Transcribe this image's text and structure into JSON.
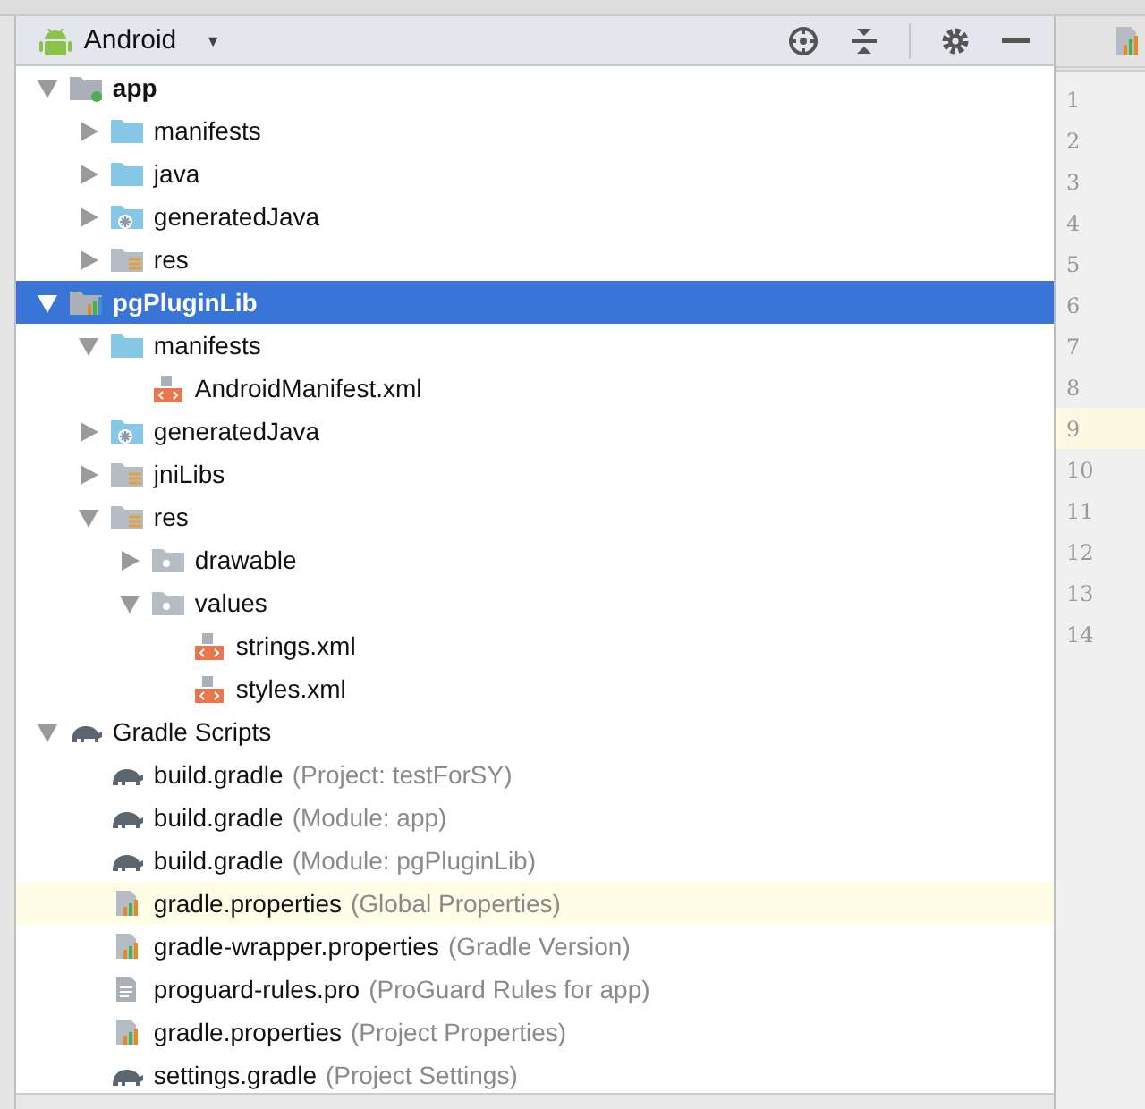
{
  "toolbar": {
    "view": "Android",
    "caret": "▼"
  },
  "tree": [
    {
      "label": "app",
      "kind": "module-app",
      "bold": true,
      "expanded": true,
      "selected": false,
      "children": [
        {
          "label": "manifests",
          "kind": "folder",
          "expanded": false,
          "selected": false
        },
        {
          "label": "java",
          "kind": "folder",
          "expanded": false,
          "selected": false
        },
        {
          "label": "generatedJava",
          "kind": "gen-folder",
          "expanded": false,
          "selected": false
        },
        {
          "label": "res",
          "kind": "res-folder",
          "expanded": false,
          "selected": false
        }
      ]
    },
    {
      "label": "pgPluginLib",
      "kind": "module-lib",
      "bold": true,
      "expanded": true,
      "selected": true,
      "children": [
        {
          "label": "manifests",
          "kind": "folder",
          "expanded": true,
          "selected": false,
          "children": [
            {
              "label": "AndroidManifest.xml",
              "kind": "xml",
              "selected": false
            }
          ]
        },
        {
          "label": "generatedJava",
          "kind": "gen-folder",
          "expanded": false,
          "selected": false
        },
        {
          "label": "jniLibs",
          "kind": "res-folder",
          "expanded": false,
          "selected": false
        },
        {
          "label": "res",
          "kind": "res-folder",
          "expanded": true,
          "selected": false,
          "children": [
            {
              "label": "drawable",
              "kind": "gray-folder",
              "expanded": false,
              "selected": false
            },
            {
              "label": "values",
              "kind": "gray-folder",
              "expanded": true,
              "selected": false,
              "children": [
                {
                  "label": "strings.xml",
                  "kind": "xml",
                  "selected": false
                },
                {
                  "label": "styles.xml",
                  "kind": "xml",
                  "selected": false
                }
              ]
            }
          ]
        }
      ]
    },
    {
      "label": "Gradle Scripts",
      "kind": "gradle",
      "expanded": true,
      "selected": false,
      "children": [
        {
          "label": "build.gradle",
          "hint": "(Project: testForSY)",
          "kind": "gradle",
          "selected": false
        },
        {
          "label": "build.gradle",
          "hint": "(Module: app)",
          "kind": "gradle",
          "selected": false
        },
        {
          "label": "build.gradle",
          "hint": "(Module: pgPluginLib)",
          "kind": "gradle",
          "selected": false
        },
        {
          "label": "gradle.properties",
          "hint": "(Global Properties)",
          "kind": "props",
          "selected": false,
          "highlighted": true
        },
        {
          "label": "gradle-wrapper.properties",
          "hint": "(Gradle Version)",
          "kind": "props",
          "selected": false
        },
        {
          "label": "proguard-rules.pro",
          "hint": "(ProGuard Rules for app)",
          "kind": "text",
          "selected": false
        },
        {
          "label": "gradle.properties",
          "hint": "(Project Properties)",
          "kind": "props",
          "selected": false
        },
        {
          "label": "settings.gradle",
          "hint": "(Project Settings)",
          "kind": "gradle",
          "selected": false
        }
      ]
    }
  ],
  "editor": {
    "lines": [
      {
        "number": "1",
        "current": false
      },
      {
        "number": "2",
        "current": false
      },
      {
        "number": "3",
        "current": false
      },
      {
        "number": "4",
        "current": false
      },
      {
        "number": "5",
        "current": false
      },
      {
        "number": "6",
        "current": false
      },
      {
        "number": "7",
        "current": false
      },
      {
        "number": "8",
        "current": false
      },
      {
        "number": "9",
        "current": true
      },
      {
        "number": "10",
        "current": false
      },
      {
        "number": "11",
        "current": false
      },
      {
        "number": "12",
        "current": false
      },
      {
        "number": "13",
        "current": false
      },
      {
        "number": "14",
        "current": false
      }
    ]
  }
}
